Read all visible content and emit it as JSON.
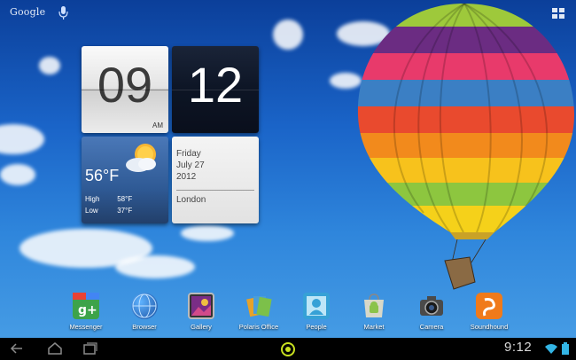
{
  "search": {
    "logo": "Google",
    "mic_icon": "microphone-icon"
  },
  "clock": {
    "hour": "09",
    "minute": "12",
    "ampm": "AM"
  },
  "weather": {
    "temp": "56°F",
    "high_label": "High",
    "high": "58°F",
    "low_label": "Low",
    "low": "37°F",
    "icon": "partly-cloudy-icon"
  },
  "date": {
    "weekday": "Friday",
    "month_day": "July 27",
    "year": "2012",
    "city": "London"
  },
  "dock": [
    {
      "label": "Messenger",
      "icon": "google-plus-icon",
      "color": "#3da34a"
    },
    {
      "label": "Browser",
      "icon": "globe-icon",
      "color": "#1f74c9"
    },
    {
      "label": "Gallery",
      "icon": "gallery-icon",
      "color": "#7a2d86"
    },
    {
      "label": "Polaris Office",
      "icon": "documents-icon",
      "color": "#e6a22a"
    },
    {
      "label": "People",
      "icon": "contacts-icon",
      "color": "#36a1d6"
    },
    {
      "label": "Market",
      "icon": "market-icon",
      "color": "#8bc34a"
    },
    {
      "label": "Camera",
      "icon": "camera-icon",
      "color": "#5a5a5a"
    },
    {
      "label": "Soundhound",
      "icon": "soundhound-icon",
      "color": "#f07a1a"
    }
  ],
  "status": {
    "time": "9:12"
  },
  "colors": {
    "accent": "#33b5e5",
    "home_ring": "#c8e020"
  }
}
